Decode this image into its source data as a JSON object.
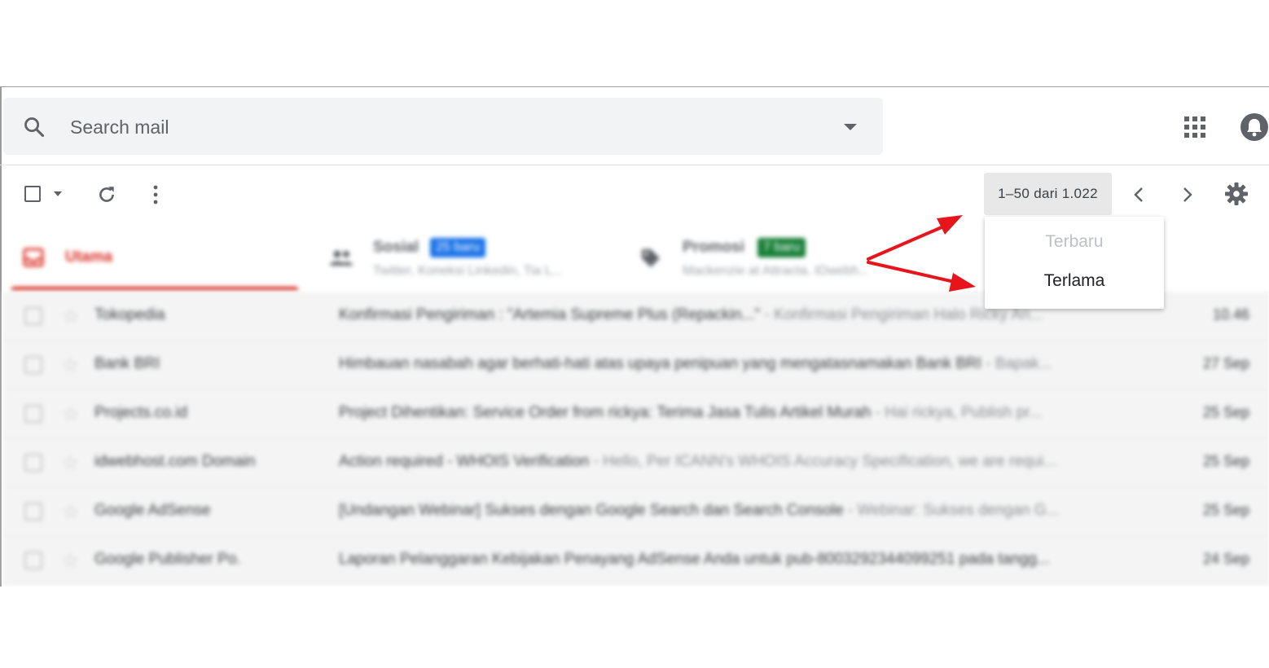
{
  "search": {
    "placeholder": "Search mail"
  },
  "toolbar": {
    "pager_text": "1–50 dari 1.022"
  },
  "tabs": [
    {
      "label": "Utama",
      "color": "#d93025"
    },
    {
      "label": "Sosial",
      "badge": "25 baru",
      "badge_color": "#1a73e8",
      "subtitle": "Twitter, Koneksi Linkedin, Tia L...",
      "icon": "people-icon"
    },
    {
      "label": "Promosi",
      "badge": "7 baru",
      "badge_color": "#188038",
      "subtitle": "Mackenzie at Attracta, IDwebh...",
      "icon": "tag-icon"
    }
  ],
  "sort_menu": {
    "items": [
      {
        "label": "Terbaru",
        "enabled": false
      },
      {
        "label": "Terlama",
        "enabled": true
      }
    ]
  },
  "emails": [
    {
      "sender": "Tokopedia",
      "subject": "Konfirmasi Pengiriman : \"Artemia Supreme Plus (Repackin...\"",
      "snippet": " - Konfirmasi Pengiriman Halo Ricky An...",
      "date": "10.46"
    },
    {
      "sender": "Bank BRI",
      "subject": "Himbauan nasabah agar berhati-hati atas upaya penipuan yang mengatasnamakan Bank BRI",
      "snippet": " - Bapak...",
      "date": "27 Sep"
    },
    {
      "sender": "Projects.co.id",
      "subject": "Project Dihentikan: Service Order from rickya: Terima Jasa Tulis Artikel Murah",
      "snippet": " - Hai rickya, Publish pr...",
      "date": "25 Sep"
    },
    {
      "sender": "idwebhost.com Domain",
      "subject": "Action required - WHOIS Verification",
      "snippet": " - Hello, Per ICANN's WHOIS Accuracy Specification, we are requi...",
      "date": "25 Sep"
    },
    {
      "sender": "Google AdSense",
      "subject": "[Undangan Webinar] Sukses dengan Google Search dan Search Console",
      "snippet": " - Webinar: Sukses dengan G...",
      "date": "25 Sep"
    },
    {
      "sender": "Google Publisher Po.",
      "subject": "Laporan Pelanggaran Kebijakan Penayang AdSense Anda untuk pub-8003292344099251 pada tangg...",
      "snippet": "",
      "date": "24 Sep"
    }
  ],
  "annotation": {
    "arrow_color": "#e8141c"
  }
}
